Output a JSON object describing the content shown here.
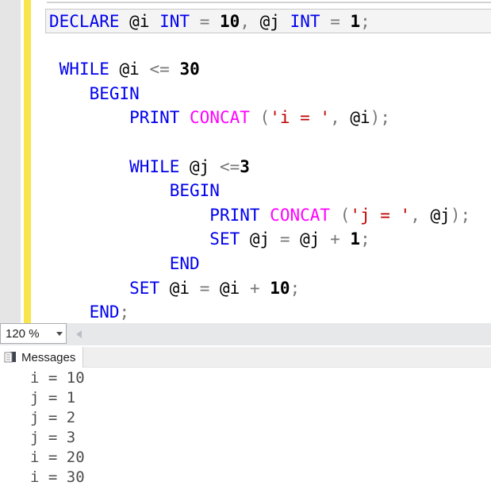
{
  "colors": {
    "keyword": "#0000ee",
    "system_function": "#ff00ff",
    "string": "#c00000",
    "operator": "#787878",
    "number": "#000000",
    "change_tracking_bar": "#f8e54b",
    "highlight_border": "#c8c8c8"
  },
  "editor": {
    "zoom_level": "120 %",
    "lines": [
      {
        "highlight": true,
        "tokens": [
          {
            "text": "DECLARE",
            "type": "kw"
          },
          {
            "text": " ",
            "type": "pl"
          },
          {
            "text": "@i",
            "type": "id"
          },
          {
            "text": " ",
            "type": "pl"
          },
          {
            "text": "INT",
            "type": "kw"
          },
          {
            "text": " ",
            "type": "pl"
          },
          {
            "text": "=",
            "type": "op"
          },
          {
            "text": " ",
            "type": "pl"
          },
          {
            "text": "10",
            "type": "num"
          },
          {
            "text": ",",
            "type": "op"
          },
          {
            "text": " ",
            "type": "pl"
          },
          {
            "text": "@j",
            "type": "id"
          },
          {
            "text": " ",
            "type": "pl"
          },
          {
            "text": "INT",
            "type": "kw"
          },
          {
            "text": " ",
            "type": "pl"
          },
          {
            "text": "=",
            "type": "op"
          },
          {
            "text": " ",
            "type": "pl"
          },
          {
            "text": "1",
            "type": "num"
          },
          {
            "text": ";",
            "type": "op"
          }
        ]
      },
      {
        "highlight": false,
        "tokens": []
      },
      {
        "highlight": false,
        "tokens": [
          {
            "text": " ",
            "type": "pl"
          },
          {
            "text": "WHILE",
            "type": "kw"
          },
          {
            "text": " ",
            "type": "pl"
          },
          {
            "text": "@i",
            "type": "id"
          },
          {
            "text": " ",
            "type": "pl"
          },
          {
            "text": "<=",
            "type": "op"
          },
          {
            "text": " ",
            "type": "pl"
          },
          {
            "text": "30",
            "type": "num"
          }
        ]
      },
      {
        "highlight": false,
        "tokens": [
          {
            "text": "    ",
            "type": "pl"
          },
          {
            "text": "BEGIN",
            "type": "kw"
          }
        ]
      },
      {
        "highlight": false,
        "tokens": [
          {
            "text": "        ",
            "type": "pl"
          },
          {
            "text": "PRINT",
            "type": "kw"
          },
          {
            "text": " ",
            "type": "pl"
          },
          {
            "text": "CONCAT",
            "type": "fn"
          },
          {
            "text": " ",
            "type": "pl"
          },
          {
            "text": "(",
            "type": "op"
          },
          {
            "text": "'i = '",
            "type": "str"
          },
          {
            "text": ",",
            "type": "op"
          },
          {
            "text": " ",
            "type": "pl"
          },
          {
            "text": "@i",
            "type": "id"
          },
          {
            "text": ")",
            "type": "op"
          },
          {
            "text": ";",
            "type": "op"
          }
        ]
      },
      {
        "highlight": false,
        "tokens": []
      },
      {
        "highlight": false,
        "tokens": [
          {
            "text": "        ",
            "type": "pl"
          },
          {
            "text": "WHILE",
            "type": "kw"
          },
          {
            "text": " ",
            "type": "pl"
          },
          {
            "text": "@j",
            "type": "id"
          },
          {
            "text": " ",
            "type": "pl"
          },
          {
            "text": "<=",
            "type": "op"
          },
          {
            "text": "3",
            "type": "num"
          }
        ]
      },
      {
        "highlight": false,
        "tokens": [
          {
            "text": "            ",
            "type": "pl"
          },
          {
            "text": "BEGIN",
            "type": "kw"
          }
        ]
      },
      {
        "highlight": false,
        "tokens": [
          {
            "text": "                ",
            "type": "pl"
          },
          {
            "text": "PRINT",
            "type": "kw"
          },
          {
            "text": " ",
            "type": "pl"
          },
          {
            "text": "CONCAT",
            "type": "fn"
          },
          {
            "text": " ",
            "type": "pl"
          },
          {
            "text": "(",
            "type": "op"
          },
          {
            "text": "'j = '",
            "type": "str"
          },
          {
            "text": ",",
            "type": "op"
          },
          {
            "text": " ",
            "type": "pl"
          },
          {
            "text": "@j",
            "type": "id"
          },
          {
            "text": ")",
            "type": "op"
          },
          {
            "text": ";",
            "type": "op"
          }
        ]
      },
      {
        "highlight": false,
        "tokens": [
          {
            "text": "                ",
            "type": "pl"
          },
          {
            "text": "SET",
            "type": "kw"
          },
          {
            "text": " ",
            "type": "pl"
          },
          {
            "text": "@j",
            "type": "id"
          },
          {
            "text": " ",
            "type": "pl"
          },
          {
            "text": "=",
            "type": "op"
          },
          {
            "text": " ",
            "type": "pl"
          },
          {
            "text": "@j",
            "type": "id"
          },
          {
            "text": " ",
            "type": "pl"
          },
          {
            "text": "+",
            "type": "op"
          },
          {
            "text": " ",
            "type": "pl"
          },
          {
            "text": "1",
            "type": "num"
          },
          {
            "text": ";",
            "type": "op"
          }
        ]
      },
      {
        "highlight": false,
        "tokens": [
          {
            "text": "            ",
            "type": "pl"
          },
          {
            "text": "END",
            "type": "kw"
          }
        ]
      },
      {
        "highlight": false,
        "tokens": [
          {
            "text": "        ",
            "type": "pl"
          },
          {
            "text": "SET",
            "type": "kw"
          },
          {
            "text": " ",
            "type": "pl"
          },
          {
            "text": "@i",
            "type": "id"
          },
          {
            "text": " ",
            "type": "pl"
          },
          {
            "text": "=",
            "type": "op"
          },
          {
            "text": " ",
            "type": "pl"
          },
          {
            "text": "@i",
            "type": "id"
          },
          {
            "text": " ",
            "type": "pl"
          },
          {
            "text": "+",
            "type": "op"
          },
          {
            "text": " ",
            "type": "pl"
          },
          {
            "text": "10",
            "type": "num"
          },
          {
            "text": ";",
            "type": "op"
          }
        ]
      },
      {
        "highlight": false,
        "tokens": [
          {
            "text": "    ",
            "type": "pl"
          },
          {
            "text": "END",
            "type": "kw"
          },
          {
            "text": ";",
            "type": "op"
          }
        ]
      }
    ]
  },
  "results_pane": {
    "tab_label": "Messages",
    "messages": [
      "i = 10",
      "j = 1",
      "j = 2",
      "j = 3",
      "i = 20",
      "i = 30"
    ]
  }
}
